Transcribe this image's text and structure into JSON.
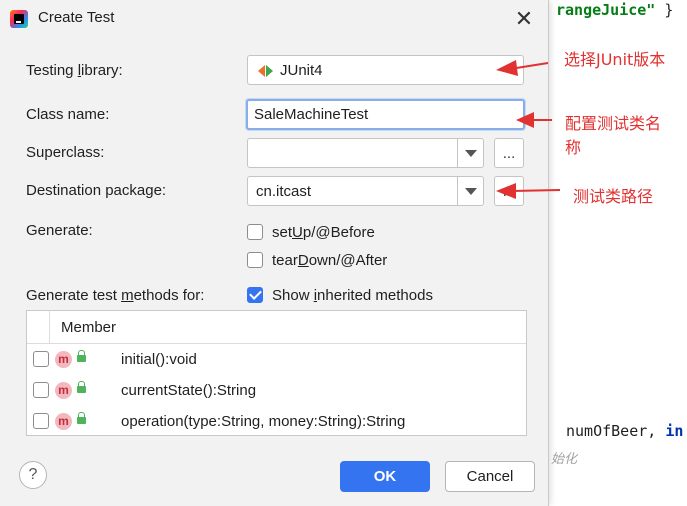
{
  "editor": {
    "code_top_string": "rangeJuice\"",
    "code_top_brace": " }",
    "code_mid_text": "numOfBeer, ",
    "code_mid_kw": "in",
    "code_faded": "始化"
  },
  "dialog": {
    "title": "Create Test",
    "fields": {
      "testing_library": {
        "label_pre": "Testing ",
        "label_u": "l",
        "label_post": "ibrary:",
        "value": "JUnit4"
      },
      "class_name": {
        "label": "Class name:",
        "value": "SaleMachineTest"
      },
      "superclass": {
        "label": "Superclass:",
        "value": ""
      },
      "destination_package": {
        "label": "Destination package:",
        "value": "cn.itcast"
      }
    },
    "dots_label": "...",
    "generate": {
      "label": "Generate:",
      "setup": {
        "pre": "set",
        "u": "U",
        "post": "p/@Before",
        "checked": false
      },
      "teardown": {
        "pre": "tear",
        "u": "D",
        "post": "own/@After",
        "checked": false
      }
    },
    "methods_for": {
      "label_pre": "Generate test ",
      "label_u": "m",
      "label_post": "ethods for:",
      "show_inherited": {
        "pre": "Show ",
        "u": "i",
        "post": "nherited methods",
        "checked": true
      }
    },
    "table": {
      "header": "Member",
      "rows": [
        {
          "icon": "m",
          "method": "initial():void"
        },
        {
          "icon": "m",
          "method": "currentState():String"
        },
        {
          "icon": "m",
          "method": "operation(type:String, money:String):String"
        }
      ]
    },
    "buttons": {
      "help": "?",
      "ok": "OK",
      "cancel": "Cancel"
    }
  },
  "annotations": {
    "note1": "选择JUnit版本",
    "note2_line1": "配置测试类名",
    "note2_line2": "称",
    "note3": "测试类路径",
    "color": "#e23131"
  }
}
